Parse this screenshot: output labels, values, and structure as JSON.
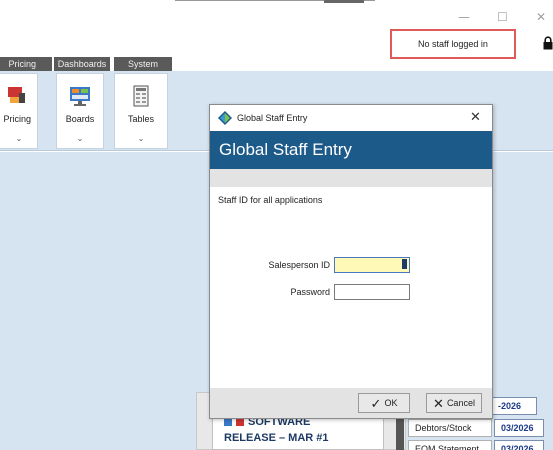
{
  "window": {
    "minimize_glyph": "—",
    "maximize_glyph": "☐",
    "close_glyph": "✕",
    "status_text": "No staff logged in"
  },
  "ribbon": {
    "tabs": [
      {
        "label": "Pricing"
      },
      {
        "label": "Dashboards"
      },
      {
        "label": "System"
      }
    ],
    "buttons": [
      {
        "label": "Pricing",
        "icon": "pricing-icon"
      },
      {
        "label": "Boards",
        "icon": "boards-icon"
      },
      {
        "label": "Tables",
        "icon": "tables-icon"
      }
    ],
    "chevron": "⌄"
  },
  "dialog": {
    "title": "Global Staff Entry",
    "header": "Global Staff Entry",
    "description": "Staff ID for all applications",
    "fields": {
      "salesperson_label": "Salesperson ID",
      "salesperson_value": "",
      "password_label": "Password",
      "password_value": ""
    },
    "ok": {
      "mark": "✓",
      "label": "OK"
    },
    "cancel": {
      "mark": "✕",
      "label": "Cancel"
    }
  },
  "background": {
    "card_line1": "SOFTWARE",
    "card_line2": "RELEASE – MAR #1",
    "rows": [
      {
        "label": "",
        "value": "-2026"
      },
      {
        "label": "Debtors/Stock",
        "value": "03/2026"
      },
      {
        "label": "EOM Statement",
        "value": "03/2026"
      }
    ]
  },
  "colors": {
    "ribbon_bg": "#d6e4f1",
    "dialog_header": "#1c5a8a",
    "highlight_border": "#e05a5a",
    "focused_field": "#fff9b8"
  }
}
